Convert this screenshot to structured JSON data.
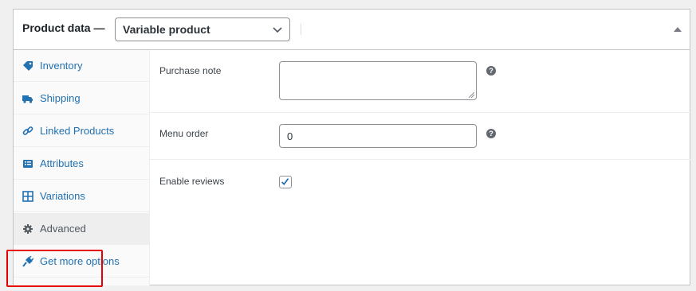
{
  "header": {
    "title": "Product data —",
    "product_type": "Variable product"
  },
  "tabs": [
    {
      "label": "Inventory",
      "icon": "tag-icon"
    },
    {
      "label": "Shipping",
      "icon": "truck-icon"
    },
    {
      "label": "Linked Products",
      "icon": "link-icon"
    },
    {
      "label": "Attributes",
      "icon": "list-icon"
    },
    {
      "label": "Variations",
      "icon": "grid-icon"
    },
    {
      "label": "Advanced",
      "icon": "gear-icon",
      "active": true
    },
    {
      "label": "Get more options",
      "icon": "plugin-icon"
    }
  ],
  "fields": {
    "purchase_note": {
      "label": "Purchase note",
      "value": ""
    },
    "menu_order": {
      "label": "Menu order",
      "value": "0"
    },
    "enable_reviews": {
      "label": "Enable reviews",
      "checked": true
    }
  },
  "help_glyph": "?",
  "colors": {
    "link": "#2271b1",
    "highlight": "#e60000",
    "border": "#c3c4c7"
  }
}
